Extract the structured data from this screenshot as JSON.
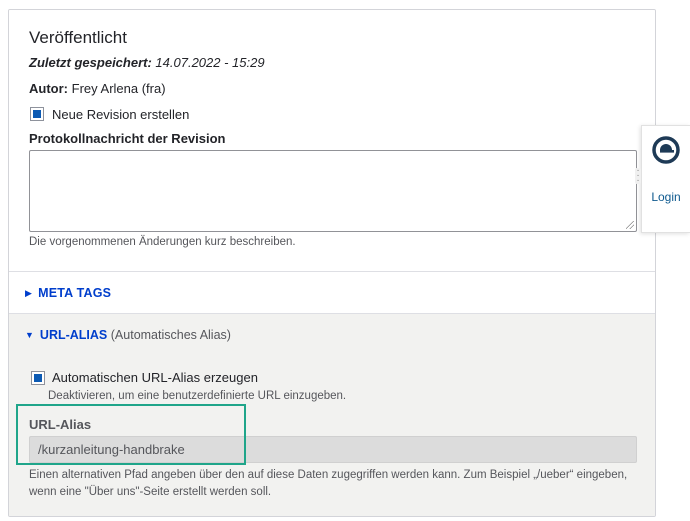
{
  "published": {
    "title": "Veröffentlicht",
    "saved_label": "Zuletzt gespeichert:",
    "saved_value": "14.07.2022 - 15:29",
    "author_label": "Autor:",
    "author_value": "Frey Arlena (fra)",
    "new_revision_label": "Neue Revision erstellen",
    "revision_log_label": "Protokollnachricht der Revision",
    "revision_log_value": "",
    "revision_log_description": "Die vorgenommenen Änderungen kurz beschreiben."
  },
  "meta_tags": {
    "label": "META TAGS",
    "expanded": false
  },
  "url_alias": {
    "label": "URL-ALIAS",
    "summary": "(Automatisches Alias)",
    "expanded": true,
    "auto_label": "Automatischen URL-Alias erzeugen",
    "auto_description": "Deaktivieren, um eine benutzerdefinierte URL einzugeben.",
    "field_label": "URL-Alias",
    "field_value": "/kurzanleitung-handbrake",
    "field_description": "Einen alternativen Pfad angeben über den auf diese Daten zugegriffen werden kann. Zum Beispiel „/ueber“ eingeben, wenn eine \"Über uns\"-Seite erstellt werden soll."
  },
  "login_widget": {
    "label": "Login",
    "logo_icon": "circle-logo-icon"
  },
  "colors": {
    "link": "#003ecc",
    "checkbox": "#0c5ab3",
    "highlight": "#1fa58a",
    "login_text": "#0f5a8f"
  }
}
